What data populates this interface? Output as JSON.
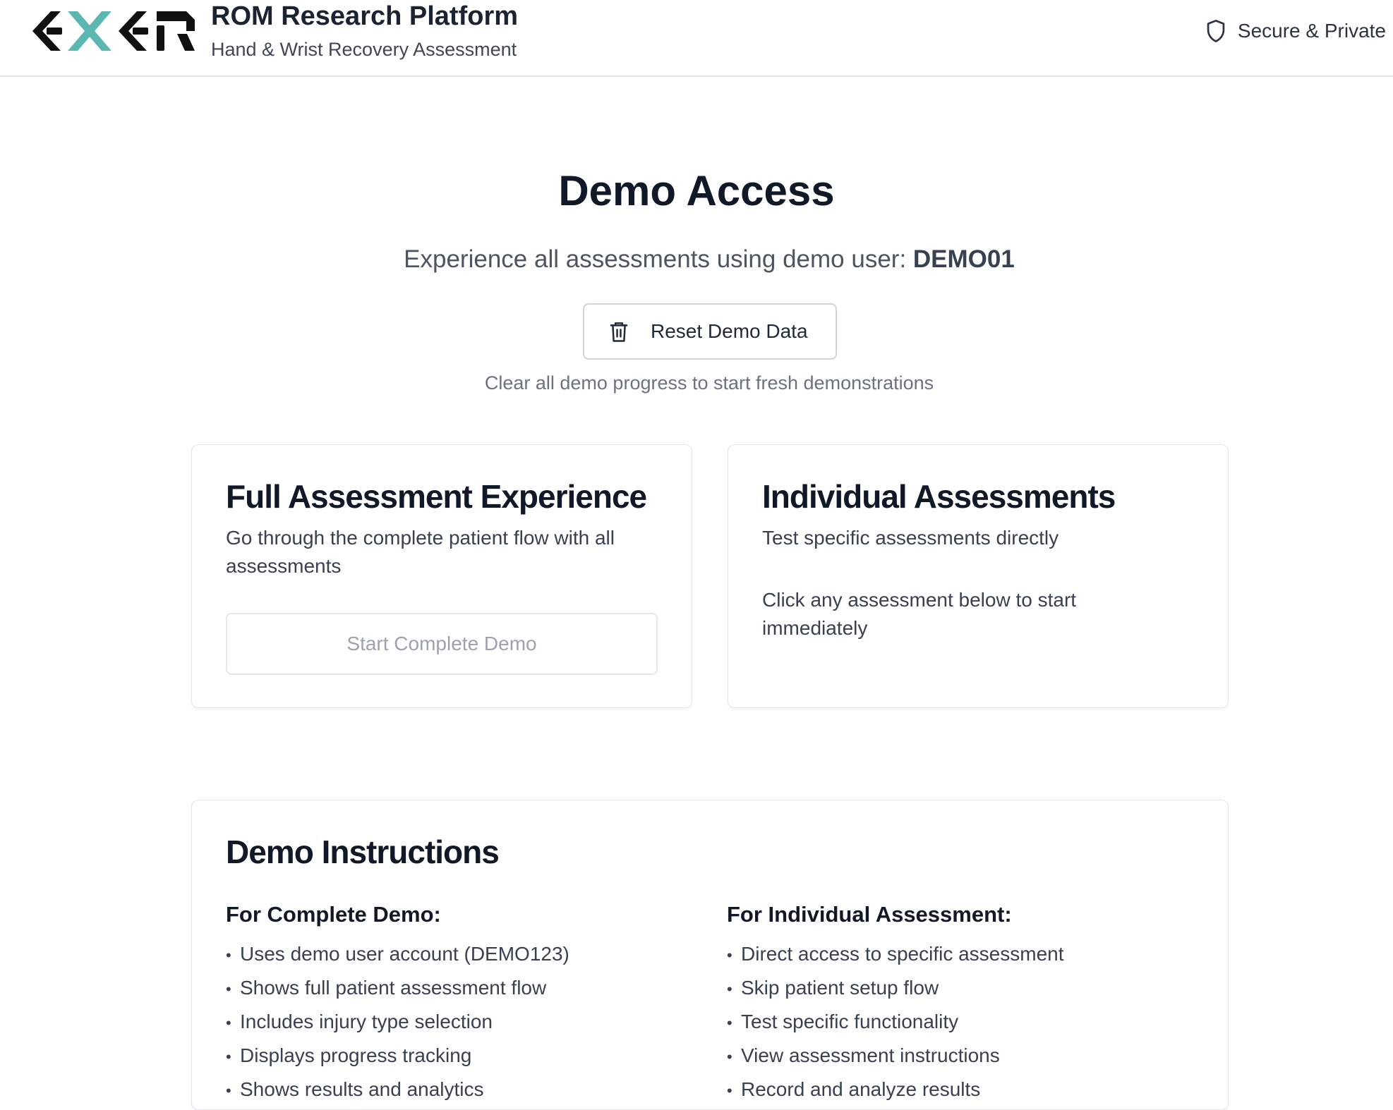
{
  "header": {
    "brand_title": "ROM Research Platform",
    "brand_subtitle": "Hand & Wrist Recovery Assessment",
    "secure_label": "Secure & Private",
    "logo_text": "EXER",
    "logo_accent_color": "#5bb8b0"
  },
  "hero": {
    "title": "Demo Access",
    "subtitle_prefix": "Experience all assessments using demo user:",
    "demo_user": "DEMO01",
    "reset_label": "Reset Demo Data",
    "reset_note": "Clear all demo progress to start fresh demonstrations"
  },
  "full_card": {
    "title": "Full Assessment Experience",
    "description": "Go through the complete patient flow with all assessments",
    "button_label": "Start Complete Demo"
  },
  "individual_card": {
    "title": "Individual Assessments",
    "description": "Test specific assessments directly",
    "hint": "Click any assessment below to start immediately"
  },
  "instructions": {
    "title": "Demo Instructions",
    "complete": {
      "heading": "For Complete Demo:",
      "items": [
        "Uses demo user account (DEMO123)",
        "Shows full patient assessment flow",
        "Includes injury type selection",
        "Displays progress tracking",
        "Shows results and analytics"
      ]
    },
    "individual": {
      "heading": "For Individual Assessment:",
      "items": [
        "Direct access to specific assessment",
        "Skip patient setup flow",
        "Test specific functionality",
        "View assessment instructions",
        "Record and analyze results"
      ]
    }
  },
  "icons": {
    "secure": "shield-icon",
    "reset": "trash-icon"
  }
}
